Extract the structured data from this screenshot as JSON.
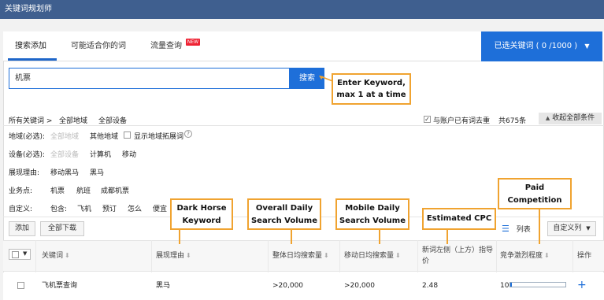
{
  "header": {
    "title": "关键词规划师"
  },
  "tabs": [
    {
      "label": "搜索添加"
    },
    {
      "label": "可能适合你的词"
    },
    {
      "label": "流量查询"
    }
  ],
  "new_badge": "NEW",
  "selected_keywords": "已选关键词 ( 0 /1000 )",
  "search": {
    "value": "机票",
    "button": "搜索"
  },
  "callouts": {
    "enter_keyword": "Enter Keyword, max 1 at a time",
    "dark_horse": "Dark Horse Keyword",
    "overall_volume": "Overall Daily Search Volume",
    "mobile_volume": "Mobile Daily Search Volume",
    "cpc": "Estimated CPC",
    "paid_competition": "Paid Competition"
  },
  "filters": {
    "all_keywords": "所有关键词 >",
    "all_regions": "全部地域",
    "all_devices": "全部设备",
    "dedupe": "与账户已有词去重",
    "total": "共675条",
    "collapse": "收起全部条件",
    "region_label": "地域(必选):",
    "region_all": "全部地域",
    "region_other": "其他地域",
    "show_region_expand": "显示地域拓展词",
    "device_label": "设备(必选):",
    "device_all": "全部设备",
    "device_pc": "计算机",
    "device_mobile": "移动",
    "reason_label": "展现理由:",
    "reason_mobile_dh": "移动黑马",
    "reason_dh": "黑马",
    "business_label": "业务点:",
    "business_1": "机票",
    "business_2": "航班",
    "business_3": "成都机票",
    "custom_label": "自定义:",
    "custom_include": "包含:",
    "custom_1": "飞机",
    "custom_2": "预订",
    "custom_3": "怎么",
    "custom_4": "便宜"
  },
  "toolbar": {
    "add": "添加",
    "download_all": "全部下载",
    "list_view": "列表",
    "custom_columns": "自定义列"
  },
  "table": {
    "headers": [
      "关键词",
      "展现理由",
      "整体日均搜索量",
      "移动日均搜索量",
      "新词左侧（上方）指导价",
      "竞争激烈程度",
      "操作"
    ],
    "rows": [
      {
        "keyword": "飞机票查询",
        "reason": "黑马",
        "overall": ">20,000",
        "mobile": ">20,000",
        "cpc": "2.48",
        "competition": "10",
        "competition_level": 0.03
      }
    ]
  }
}
